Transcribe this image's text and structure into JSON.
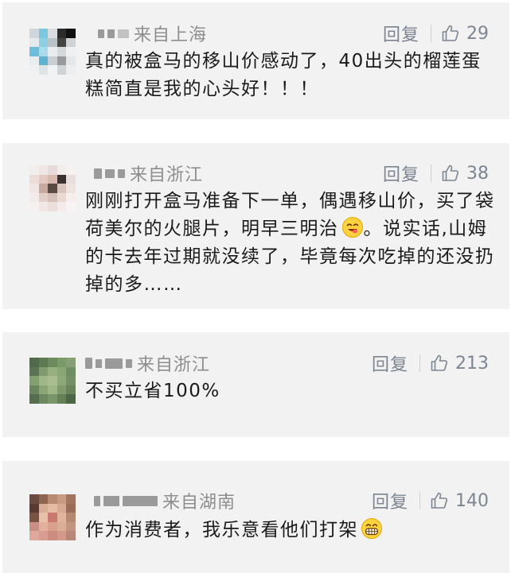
{
  "comments": [
    {
      "location": "来自上海",
      "reply_label": "回复",
      "likes": "29",
      "text": "真的被盒马的移山价感动了，40出头的榴莲蛋糕简直是我的心头好！！！",
      "avatar_icon": "user-avatar"
    },
    {
      "location": "来自浙江",
      "reply_label": "回复",
      "likes": "38",
      "text": "刚刚打开盒马准备下一单，偶遇移山价，买了袋荷美尔的火腿片，明早三明治",
      "text_tail": "。说实话,山姆的卡去年过期就没续了，毕竟每次吃掉的还没扔掉的多……",
      "emoji_icon": "yummy-face-emoji",
      "avatar_icon": "user-avatar"
    },
    {
      "location": "来自浙江",
      "reply_label": "回复",
      "likes": "213",
      "text": "不买立省100%",
      "avatar_icon": "user-avatar"
    },
    {
      "location": "来自湖南",
      "reply_label": "回复",
      "likes": "140",
      "text": "作为消费者，我乐意看他们打架",
      "emoji_icon": "grinning-face-emoji",
      "avatar_icon": "user-avatar"
    }
  ],
  "colors": {
    "card_bg": "#f2f2f2",
    "text": "#1a1a1a",
    "meta": "#8d8d8d",
    "action": "#7c8591"
  }
}
